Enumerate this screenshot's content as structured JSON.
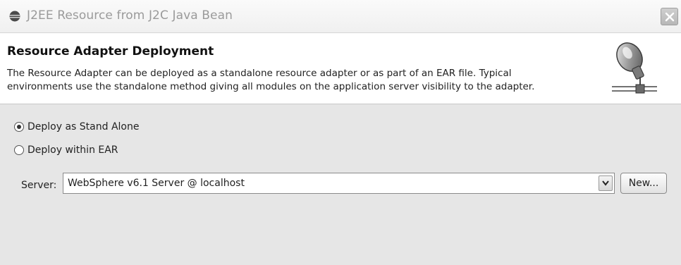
{
  "window": {
    "title": "J2EE Resource from J2C Java Bean"
  },
  "banner": {
    "title": "Resource Adapter Deployment",
    "description_line1": "The Resource Adapter can be deployed as a standalone resource adapter or as part of an EAR file.  Typical",
    "description_line2": "environments use the standalone method giving all modules on the application server visibility to the adapter.",
    "icon": "server-adapter-icon"
  },
  "deployment": {
    "options": [
      {
        "label": "Deploy as Stand Alone",
        "selected": true
      },
      {
        "label": "Deploy within EAR",
        "selected": false
      }
    ]
  },
  "server": {
    "label": "Server:",
    "value": "WebSphere v6.1 Server @ localhost",
    "new_button": "New..."
  }
}
